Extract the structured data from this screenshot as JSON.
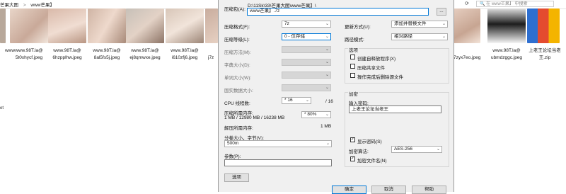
{
  "explorer": {
    "breadcrumb": [
      "芒果大图",
      ">",
      "www芒果】"
    ],
    "search_placeholder": "在 www芒果】 中搜索",
    "files": [
      {
        "name_line1": "",
        "name_line2": ""
      },
      {
        "name_line1": "www.98T.la@",
        "name_line2": "5t0xhycf.jpeg"
      },
      {
        "name_line1": "www.98T.la@",
        "name_line2": "6hzpplhw.jpeg"
      },
      {
        "name_line1": "www.98T.la@",
        "name_line2": "8al5fs5j.jpeg"
      },
      {
        "name_line1": "www.98T.la@",
        "name_line2": "ej8qmwxe.jpeg"
      },
      {
        "name_line1": "www.98T.la@",
        "name_line2": "i610zfj6.jpeg"
      },
      {
        "name_line1": "",
        "name_line2": "j7z"
      },
      {
        "name_line1": "",
        "name_line2": "7zyx7eo.jpeg"
      },
      {
        "name_line1": "www.98T.la@",
        "name_line2": "ubmdzggc.jpeg"
      },
      {
        "name_line1": "上老王论坛当老",
        "name_line2": "王.zip"
      }
    ],
    "left_fragment_1": "www",
    "left_fragment_2": "et"
  },
  "dialog": {
    "archive_label": "压缩包(A):",
    "archive_path": "D:\\11Sk\\33\\芒果大图\\www芒果】\\",
    "archive_name": "www芒果】.7z",
    "browse": "...",
    "format_label": "压缩格式(F):",
    "format_value": "7z",
    "level_label": "压缩等级(L):",
    "level_value": "0 - 仅存储",
    "method_label": "压缩方法(M):",
    "dict_label": "字典大小(D):",
    "word_label": "单词大小(W):",
    "solid_label": "固实数据大小:",
    "cpu_label": "CPU 线程数:",
    "cpu_value": "* 16",
    "cpu_total": "/ 16",
    "mem_label": "压缩所需内存:",
    "mem_value": "1 MB / 12980 MB / 16238 MB",
    "mem_percent": "* 80%",
    "decomp_label": "解压所需内存:",
    "decomp_value": "1 MB",
    "split_label": "分卷大小，字节(V):",
    "split_value": "500m",
    "params_label": "参数(P):",
    "params_value": "",
    "options_button": "选项",
    "update_label": "更新方式(U):",
    "update_value": "添加并替换文件",
    "path_label": "路径模式:",
    "path_value": "相对路径",
    "options_title": "选项",
    "opt_sfx": "创建自释放程序(X)",
    "opt_shared": "压缩共享文件",
    "opt_delete": "操作完成后删除源文件",
    "encrypt_title": "加密",
    "password_label": "输入密码:",
    "password_value": "上老王论坛当老王",
    "show_password": "显示密码(S)",
    "enc_method_label": "加密算法:",
    "enc_method_value": "AES-256",
    "encrypt_names": "加密文件名(N)",
    "ok": "确定",
    "cancel": "取消",
    "help": "帮助"
  }
}
